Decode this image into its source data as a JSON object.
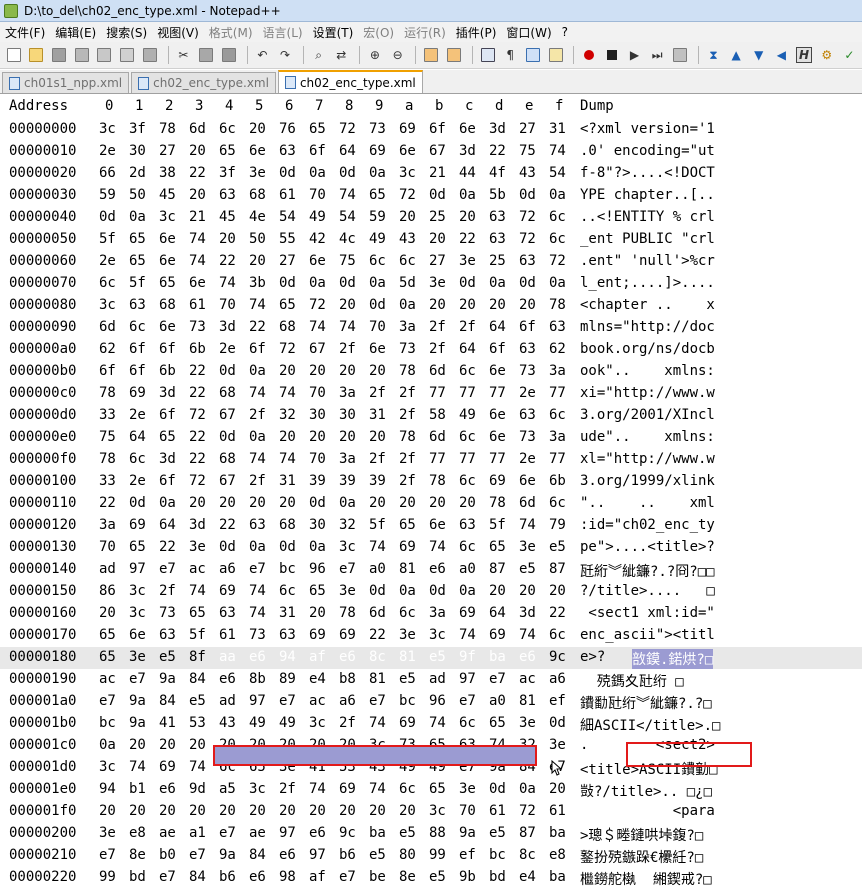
{
  "window": {
    "title": "D:\\to_del\\ch02_enc_type.xml - Notepad++"
  },
  "menu": [
    "文件(F)",
    "编辑(E)",
    "搜索(S)",
    "视图(V)",
    "格式(M)",
    "语言(L)",
    "设置(T)",
    "宏(O)",
    "运行(R)",
    "插件(P)",
    "窗口(W)",
    "?"
  ],
  "tabs": [
    "ch01s1_npp.xml",
    "ch02_enc_type.xml",
    "ch02_enc_type.xml"
  ],
  "hex_header": {
    "address": "Address",
    "columns": [
      "0",
      "1",
      "2",
      "3",
      "4",
      "5",
      "6",
      "7",
      "8",
      "9",
      "a",
      "b",
      "c",
      "d",
      "e",
      "f"
    ],
    "dump": "Dump"
  },
  "rows": [
    {
      "addr": "00000000",
      "bytes": [
        "3c",
        "3f",
        "78",
        "6d",
        "6c",
        "20",
        "76",
        "65",
        "72",
        "73",
        "69",
        "6f",
        "6e",
        "3d",
        "27",
        "31"
      ],
      "dump": "<?xml version='1"
    },
    {
      "addr": "00000010",
      "bytes": [
        "2e",
        "30",
        "27",
        "20",
        "65",
        "6e",
        "63",
        "6f",
        "64",
        "69",
        "6e",
        "67",
        "3d",
        "22",
        "75",
        "74"
      ],
      "dump": ".0' encoding=\"ut"
    },
    {
      "addr": "00000020",
      "bytes": [
        "66",
        "2d",
        "38",
        "22",
        "3f",
        "3e",
        "0d",
        "0a",
        "0d",
        "0a",
        "3c",
        "21",
        "44",
        "4f",
        "43",
        "54"
      ],
      "dump": "f-8\"?>....<!DOCT"
    },
    {
      "addr": "00000030",
      "bytes": [
        "59",
        "50",
        "45",
        "20",
        "63",
        "68",
        "61",
        "70",
        "74",
        "65",
        "72",
        "0d",
        "0a",
        "5b",
        "0d",
        "0a"
      ],
      "dump": "YPE chapter..[.."
    },
    {
      "addr": "00000040",
      "bytes": [
        "0d",
        "0a",
        "3c",
        "21",
        "45",
        "4e",
        "54",
        "49",
        "54",
        "59",
        "20",
        "25",
        "20",
        "63",
        "72",
        "6c"
      ],
      "dump": "..<!ENTITY % crl"
    },
    {
      "addr": "00000050",
      "bytes": [
        "5f",
        "65",
        "6e",
        "74",
        "20",
        "50",
        "55",
        "42",
        "4c",
        "49",
        "43",
        "20",
        "22",
        "63",
        "72",
        "6c"
      ],
      "dump": "_ent PUBLIC \"crl"
    },
    {
      "addr": "00000060",
      "bytes": [
        "2e",
        "65",
        "6e",
        "74",
        "22",
        "20",
        "27",
        "6e",
        "75",
        "6c",
        "6c",
        "27",
        "3e",
        "25",
        "63",
        "72"
      ],
      "dump": ".ent\" 'null'>%cr"
    },
    {
      "addr": "00000070",
      "bytes": [
        "6c",
        "5f",
        "65",
        "6e",
        "74",
        "3b",
        "0d",
        "0a",
        "0d",
        "0a",
        "5d",
        "3e",
        "0d",
        "0a",
        "0d",
        "0a"
      ],
      "dump": "l_ent;....]>...."
    },
    {
      "addr": "00000080",
      "bytes": [
        "3c",
        "63",
        "68",
        "61",
        "70",
        "74",
        "65",
        "72",
        "20",
        "0d",
        "0a",
        "20",
        "20",
        "20",
        "20",
        "78"
      ],
      "dump": "<chapter ..    x"
    },
    {
      "addr": "00000090",
      "bytes": [
        "6d",
        "6c",
        "6e",
        "73",
        "3d",
        "22",
        "68",
        "74",
        "74",
        "70",
        "3a",
        "2f",
        "2f",
        "64",
        "6f",
        "63"
      ],
      "dump": "mlns=\"http://doc"
    },
    {
      "addr": "000000a0",
      "bytes": [
        "62",
        "6f",
        "6f",
        "6b",
        "2e",
        "6f",
        "72",
        "67",
        "2f",
        "6e",
        "73",
        "2f",
        "64",
        "6f",
        "63",
        "62"
      ],
      "dump": "book.org/ns/docb"
    },
    {
      "addr": "000000b0",
      "bytes": [
        "6f",
        "6f",
        "6b",
        "22",
        "0d",
        "0a",
        "20",
        "20",
        "20",
        "20",
        "78",
        "6d",
        "6c",
        "6e",
        "73",
        "3a"
      ],
      "dump": "ook\"..    xmlns:"
    },
    {
      "addr": "000000c0",
      "bytes": [
        "78",
        "69",
        "3d",
        "22",
        "68",
        "74",
        "74",
        "70",
        "3a",
        "2f",
        "2f",
        "77",
        "77",
        "77",
        "2e",
        "77"
      ],
      "dump": "xi=\"http://www.w"
    },
    {
      "addr": "000000d0",
      "bytes": [
        "33",
        "2e",
        "6f",
        "72",
        "67",
        "2f",
        "32",
        "30",
        "30",
        "31",
        "2f",
        "58",
        "49",
        "6e",
        "63",
        "6c"
      ],
      "dump": "3.org/2001/XIncl"
    },
    {
      "addr": "000000e0",
      "bytes": [
        "75",
        "64",
        "65",
        "22",
        "0d",
        "0a",
        "20",
        "20",
        "20",
        "20",
        "78",
        "6d",
        "6c",
        "6e",
        "73",
        "3a"
      ],
      "dump": "ude\"..    xmlns:"
    },
    {
      "addr": "000000f0",
      "bytes": [
        "78",
        "6c",
        "3d",
        "22",
        "68",
        "74",
        "74",
        "70",
        "3a",
        "2f",
        "2f",
        "77",
        "77",
        "77",
        "2e",
        "77"
      ],
      "dump": "xl=\"http://www.w"
    },
    {
      "addr": "00000100",
      "bytes": [
        "33",
        "2e",
        "6f",
        "72",
        "67",
        "2f",
        "31",
        "39",
        "39",
        "39",
        "2f",
        "78",
        "6c",
        "69",
        "6e",
        "6b"
      ],
      "dump": "3.org/1999/xlink"
    },
    {
      "addr": "00000110",
      "bytes": [
        "22",
        "0d",
        "0a",
        "20",
        "20",
        "20",
        "20",
        "0d",
        "0a",
        "20",
        "20",
        "20",
        "20",
        "78",
        "6d",
        "6c"
      ],
      "dump": "\"..    ..    xml"
    },
    {
      "addr": "00000120",
      "bytes": [
        "3a",
        "69",
        "64",
        "3d",
        "22",
        "63",
        "68",
        "30",
        "32",
        "5f",
        "65",
        "6e",
        "63",
        "5f",
        "74",
        "79"
      ],
      "dump": ":id=\"ch02_enc_ty"
    },
    {
      "addr": "00000130",
      "bytes": [
        "70",
        "65",
        "22",
        "3e",
        "0d",
        "0a",
        "0d",
        "0a",
        "3c",
        "74",
        "69",
        "74",
        "6c",
        "65",
        "3e",
        "e5"
      ],
      "dump": "pe\">....<title>?"
    },
    {
      "addr": "00000140",
      "bytes": [
        "ad",
        "97",
        "e7",
        "ac",
        "a6",
        "e7",
        "bc",
        "96",
        "e7",
        "a0",
        "81",
        "e6",
        "a0",
        "87",
        "e5",
        "87"
      ],
      "dump": "瓩絎︾紪鐮?.?冏?□□"
    },
    {
      "addr": "00000150",
      "bytes": [
        "86",
        "3c",
        "2f",
        "74",
        "69",
        "74",
        "6c",
        "65",
        "3e",
        "0d",
        "0a",
        "0d",
        "0a",
        "20",
        "20",
        "20"
      ],
      "dump": "?/title>....   □"
    },
    {
      "addr": "00000160",
      "bytes": [
        "20",
        "3c",
        "73",
        "65",
        "63",
        "74",
        "31",
        "20",
        "78",
        "6d",
        "6c",
        "3a",
        "69",
        "64",
        "3d",
        "22"
      ],
      "dump": " <sect1 xml:id=\""
    },
    {
      "addr": "00000170",
      "bytes": [
        "65",
        "6e",
        "63",
        "5f",
        "61",
        "73",
        "63",
        "69",
        "69",
        "22",
        "3e",
        "3c",
        "74",
        "69",
        "74",
        "6c"
      ],
      "dump": "enc_ascii\"><titl"
    },
    {
      "addr": "00000180",
      "bytes": [
        "65",
        "3e",
        "e5",
        "8f",
        "aa",
        "e6",
        "94",
        "af",
        "e6",
        "8c",
        "81",
        "e5",
        "9f",
        "ba",
        "e6",
        "9c"
      ],
      "dump": "e>?",
      "dump_sel": "敨鏌.鍩烘?□"
    },
    {
      "addr": "00000190",
      "bytes": [
        "ac",
        "e7",
        "9a",
        "84",
        "e6",
        "8b",
        "89",
        "e4",
        "b8",
        "81",
        "e5",
        "ad",
        "97",
        "e7",
        "ac",
        "a6"
      ],
      "dump": "  殑鎷夊瓧绗 □"
    },
    {
      "addr": "000001a0",
      "bytes": [
        "e7",
        "9a",
        "84",
        "e5",
        "ad",
        "97",
        "e7",
        "ac",
        "a6",
        "e7",
        "bc",
        "96",
        "e7",
        "a0",
        "81",
        "ef"
      ],
      "dump": "鐨勫瓧绗︾紪鐮?.?□"
    },
    {
      "addr": "000001b0",
      "bytes": [
        "bc",
        "9a",
        "41",
        "53",
        "43",
        "49",
        "49",
        "3c",
        "2f",
        "74",
        "69",
        "74",
        "6c",
        "65",
        "3e",
        "0d"
      ],
      "dump": "細ASCII</title>.□"
    },
    {
      "addr": "000001c0",
      "bytes": [
        "0a",
        "20",
        "20",
        "20",
        "20",
        "20",
        "20",
        "20",
        "20",
        "3c",
        "73",
        "65",
        "63",
        "74",
        "32",
        "3e"
      ],
      "dump": ".        <sect2>"
    },
    {
      "addr": "000001d0",
      "bytes": [
        "3c",
        "74",
        "69",
        "74",
        "6c",
        "65",
        "3e",
        "41",
        "53",
        "43",
        "49",
        "49",
        "e7",
        "9a",
        "84",
        "e7"
      ],
      "dump": "<title>ASCII鐨勭□"
    },
    {
      "addr": "000001e0",
      "bytes": [
        "94",
        "b1",
        "e6",
        "9d",
        "a5",
        "3c",
        "2f",
        "74",
        "69",
        "74",
        "6c",
        "65",
        "3e",
        "0d",
        "0a",
        "20"
      ],
      "dump": "敱?/title>.. □¿□"
    },
    {
      "addr": "000001f0",
      "bytes": [
        "20",
        "20",
        "20",
        "20",
        "20",
        "20",
        "20",
        "20",
        "20",
        "20",
        "20",
        "3c",
        "70",
        "61",
        "72",
        "61"
      ],
      "dump": "           <para"
    },
    {
      "addr": "00000200",
      "bytes": [
        "3e",
        "e8",
        "ae",
        "a1",
        "e7",
        "ae",
        "97",
        "e6",
        "9c",
        "ba",
        "e5",
        "88",
        "9a",
        "e5",
        "87",
        "ba"
      ],
      "dump": ">璁＄畻鏈哄垰鍑?□"
    },
    {
      "addr": "00000210",
      "bytes": [
        "e7",
        "8e",
        "b0",
        "e7",
        "9a",
        "84",
        "e6",
        "97",
        "b6",
        "e5",
        "80",
        "99",
        "ef",
        "bc",
        "8c",
        "e8"
      ],
      "dump": "鐜扮殑鏃跺€欙紝?□"
    },
    {
      "addr": "00000220",
      "bytes": [
        "99",
        "bd",
        "e7",
        "84",
        "b6",
        "e6",
        "98",
        "af",
        "e7",
        "be",
        "8e",
        "e5",
        "9b",
        "bd",
        "e4",
        "ba"
      ],
      "dump": "檵鐒舵槸  緗鍥戒?□"
    }
  ]
}
